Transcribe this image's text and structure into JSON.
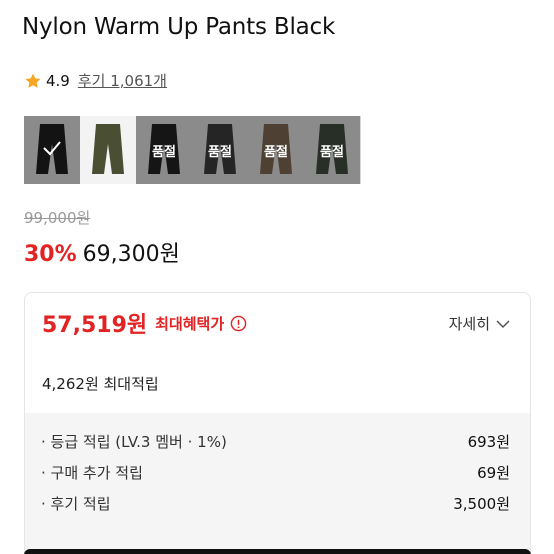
{
  "product": {
    "title": "Nylon Warm Up Pants Black",
    "rating": "4.9",
    "reviews": "후기 1,061개"
  },
  "swatches": [
    {
      "name": "black",
      "color": "#1e1e1e",
      "selected": true,
      "soldout": ""
    },
    {
      "name": "khaki",
      "color": "#4a4f33",
      "selected": false,
      "soldout": ""
    },
    {
      "name": "black-set",
      "color": "#222222",
      "selected": false,
      "soldout": "품절"
    },
    {
      "name": "charcoal-set",
      "color": "#3b3b3b",
      "selected": false,
      "soldout": "품절"
    },
    {
      "name": "brown-set",
      "color": "#7a6650",
      "selected": false,
      "soldout": "품절"
    },
    {
      "name": "green-set",
      "color": "#3f4a3d",
      "selected": false,
      "soldout": "품절"
    }
  ],
  "price": {
    "original": "99,000원",
    "discount": "30%",
    "sale": "69,300원"
  },
  "benefit": {
    "best_price": "57,519원",
    "best_label": "최대혜택가",
    "detail_label": "자세히",
    "max_points": "4,262원 최대적립",
    "lines": [
      {
        "label": "· 등급 적립 (LV.3 멤버 · 1%)",
        "value": "693원"
      },
      {
        "label": "· 구매 추가 적립",
        "value": "69원"
      },
      {
        "label": "· 후기 적립",
        "value": "3,500원"
      }
    ]
  },
  "colors": {
    "accent": "#e22323",
    "star": "#f5a623"
  }
}
